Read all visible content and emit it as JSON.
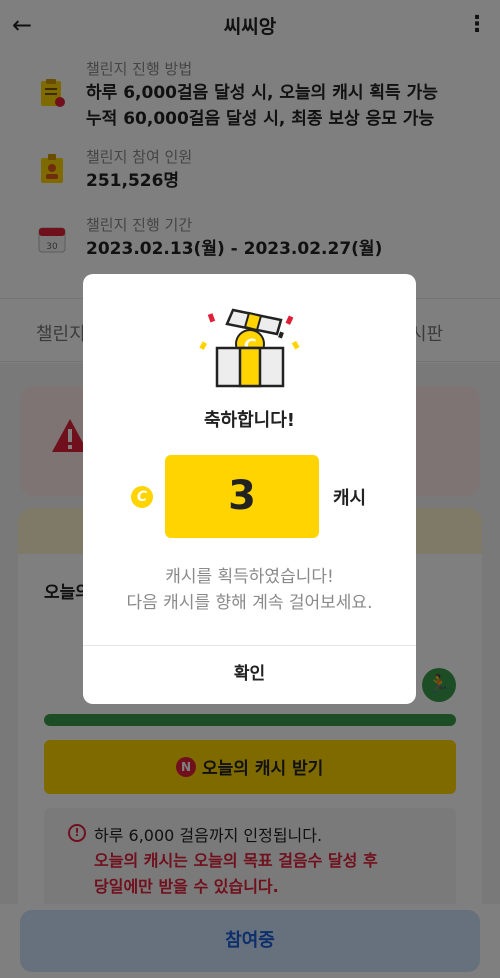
{
  "header": {
    "title": "씨씨앙"
  },
  "info": [
    {
      "label": "챌린지 진행 방법",
      "value": "하루 6,000걸음 달성 시, 오늘의 캐시 획득 가능\n누적 60,000걸음 달성 시, 최종 보상 응모 가능"
    },
    {
      "label": "챌린지 참여 인원",
      "value": "251,526명"
    },
    {
      "label": "챌린지 진행 기간",
      "value": "2023.02.13(월) - 2023.02.27(월)"
    }
  ],
  "tabs": {
    "left": "챌린지",
    "right": "시판"
  },
  "card": {
    "today_label": "오늘의",
    "cash_button": "오늘의 캐시 받기",
    "notice_line1": "하루 6,000 걸음까지 인정됩니다.",
    "notice_line2": "오늘의 캐시는 오늘의 목표 걸음수 달성 후\n당일에만 받을 수 있습니다."
  },
  "bottom": {
    "join_label": "참여중"
  },
  "modal": {
    "title": "축하합니다!",
    "amount": "3",
    "unit": "캐시",
    "message": "캐시를 획득하였습니다!\n다음 캐시를 향해 계속 걸어보세요.",
    "confirm_label": "확인"
  },
  "colors": {
    "accent_yellow": "#ffd400",
    "alert_red": "#e0203a",
    "progress_green": "#3a9a4a",
    "primary_blue": "#1a5fd6"
  }
}
